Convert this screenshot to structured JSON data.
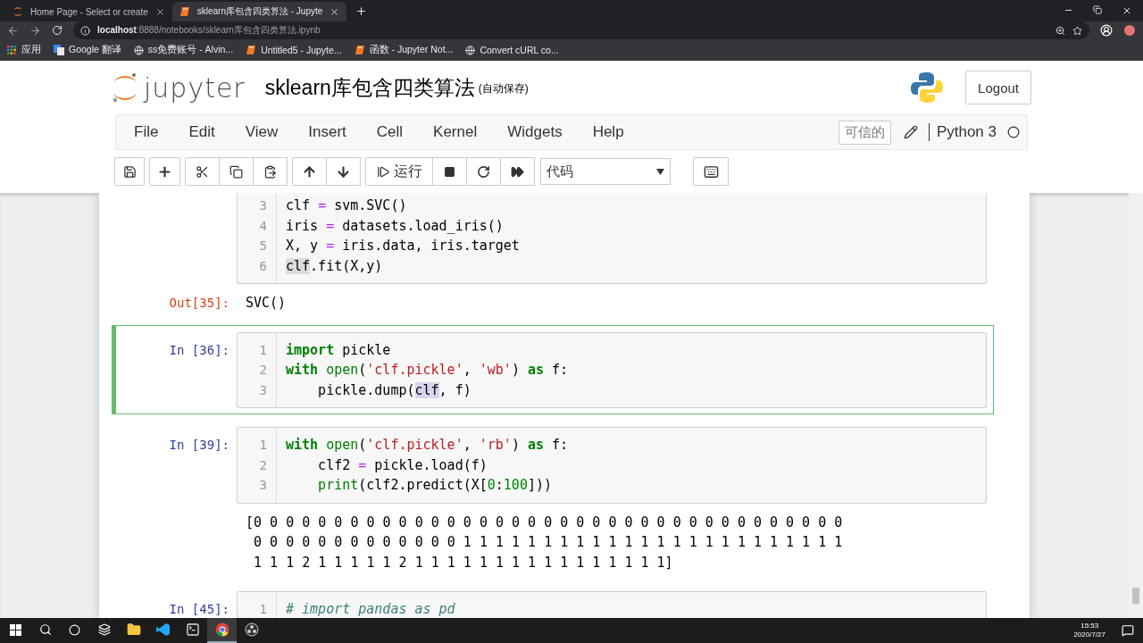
{
  "browser": {
    "tabs": [
      {
        "title": "Home Page - Select or create",
        "selected": false
      },
      {
        "title": "sklearn库包含四类算法 - Jupyte",
        "selected": true
      }
    ],
    "address": "**localhost**:8888/notebooks/sklearn库包含四类算法.ipynb",
    "bookmarks": [
      "应用",
      "Google 翻译",
      "ss免费账号 - Alvin...",
      "Untitled5 - Jupyte...",
      "函数 - Jupyter Not...",
      "Convert cURL co..."
    ]
  },
  "header": {
    "logo_text": "jupyter",
    "title": "sklearn库包含四类算法",
    "autosave": "(自动保存)",
    "logout": "Logout"
  },
  "menu": {
    "items": [
      "File",
      "Edit",
      "View",
      "Insert",
      "Cell",
      "Kernel",
      "Widgets",
      "Help"
    ],
    "trusted": "可信的",
    "kernel_name": "Python 3",
    "kernel_busy": false
  },
  "toolbar": {
    "run_label": "运行",
    "cell_type": "代码"
  },
  "cells": [
    {
      "selected": false,
      "lines": [
        {
          "number": "3",
          "tokens": [
            {
              "text": "clf ",
              "kind": "plain"
            },
            {
              "text": "=",
              "kind": "operator"
            },
            {
              "text": " svm.SVC()",
              "kind": "plain"
            }
          ]
        },
        {
          "number": "4",
          "tokens": [
            {
              "text": "iris ",
              "kind": "plain"
            },
            {
              "text": "=",
              "kind": "operator"
            },
            {
              "text": " datasets.load_iris()",
              "kind": "plain"
            }
          ]
        },
        {
          "number": "5",
          "tokens": [
            {
              "text": "X, y ",
              "kind": "plain"
            },
            {
              "text": "=",
              "kind": "operator"
            },
            {
              "text": " iris.data, iris.target",
              "kind": "plain"
            }
          ]
        },
        {
          "number": "6",
          "tokens": [
            {
              "text": "clf",
              "kind": "match"
            },
            {
              "text": ".fit(X,y)",
              "kind": "plain"
            }
          ]
        }
      ],
      "output": {
        "prompt": "Out[35]:",
        "lines": [
          "SVC()"
        ]
      }
    },
    {
      "prompt": "In [36]:",
      "selected": true,
      "lines": [
        {
          "number": "1",
          "tokens": [
            {
              "text": "import",
              "kind": "keyword"
            },
            {
              "text": " pickle",
              "kind": "plain"
            }
          ]
        },
        {
          "number": "2",
          "tokens": [
            {
              "text": "with",
              "kind": "keyword"
            },
            {
              "text": " open",
              "kind": "builtin"
            },
            {
              "text": "(",
              "kind": "plain"
            },
            {
              "text": "'clf.pickle'",
              "kind": "string"
            },
            {
              "text": ", ",
              "kind": "plain"
            },
            {
              "text": "'wb'",
              "kind": "string"
            },
            {
              "text": ") ",
              "kind": "plain"
            },
            {
              "text": "as",
              "kind": "keyword"
            },
            {
              "text": " f:",
              "kind": "plain"
            }
          ]
        },
        {
          "number": "3",
          "tokens": [
            {
              "text": "    pickle.dump(",
              "kind": "plain"
            },
            {
              "text": "clf",
              "kind": "selection"
            },
            {
              "text": ", f)",
              "kind": "plain"
            }
          ]
        }
      ]
    },
    {
      "prompt": "In [39]:",
      "selected": false,
      "lines": [
        {
          "number": "1",
          "tokens": [
            {
              "text": "with",
              "kind": "keyword"
            },
            {
              "text": " open",
              "kind": "builtin"
            },
            {
              "text": "(",
              "kind": "plain"
            },
            {
              "text": "'clf.pickle'",
              "kind": "string"
            },
            {
              "text": ", ",
              "kind": "plain"
            },
            {
              "text": "'rb'",
              "kind": "string"
            },
            {
              "text": ") ",
              "kind": "plain"
            },
            {
              "text": "as",
              "kind": "keyword"
            },
            {
              "text": " f:",
              "kind": "plain"
            }
          ]
        },
        {
          "number": "2",
          "tokens": [
            {
              "text": "    clf2 ",
              "kind": "plain"
            },
            {
              "text": "=",
              "kind": "operator"
            },
            {
              "text": " pickle.load(f)",
              "kind": "plain"
            }
          ]
        },
        {
          "number": "3",
          "tokens": [
            {
              "text": "    print",
              "kind": "builtin"
            },
            {
              "text": "(clf2.predict(X[",
              "kind": "plain"
            },
            {
              "text": "0",
              "kind": "number"
            },
            {
              "text": ":",
              "kind": "plain"
            },
            {
              "text": "100",
              "kind": "number"
            },
            {
              "text": "]))",
              "kind": "plain"
            }
          ]
        }
      ],
      "output": {
        "lines": [
          "[0 0 0 0 0 0 0 0 0 0 0 0 0 0 0 0 0 0 0 0 0 0 0 0 0 0 0 0 0 0 0 0 0 0 0 0 0",
          " 0 0 0 0 0 0 0 0 0 0 0 0 0 1 1 1 1 1 1 1 1 1 1 1 1 1 1 1 1 1 1 1 1 1 1 1 1",
          " 1 1 1 2 1 1 1 1 1 2 1 1 1 1 1 1 1 1 1 1 1 1 1 1 1 1]"
        ]
      }
    },
    {
      "prompt": "In [45]:",
      "selected": false,
      "lines": [
        {
          "number": "1",
          "tokens": [
            {
              "text": "# import pandas as pd",
              "kind": "comment"
            }
          ]
        }
      ]
    }
  ],
  "taskbar": {
    "apps": [
      {
        "selected": false
      },
      {
        "selected": false
      },
      {
        "selected": false
      },
      {
        "selected": true
      },
      {
        "selected": false
      }
    ],
    "time": "15:53",
    "date": "2020/7/27"
  }
}
